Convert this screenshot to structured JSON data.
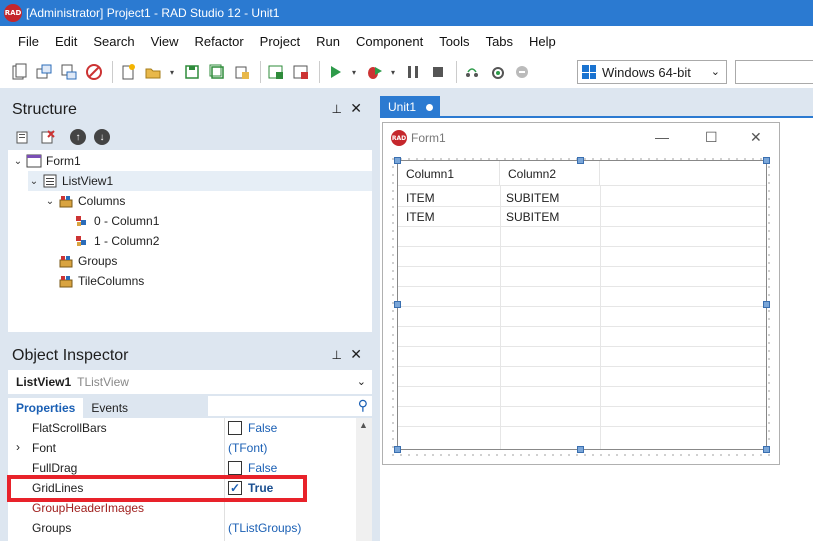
{
  "window": {
    "title": "[Administrator] Project1 - RAD Studio 12 - Unit1",
    "app_icon_text": "RAD"
  },
  "menu": [
    "File",
    "Edit",
    "Search",
    "View",
    "Refactor",
    "Project",
    "Run",
    "Component",
    "Tools",
    "Tabs",
    "Help"
  ],
  "toolbar": {
    "platform": "Windows 64-bit",
    "buttons": [
      "new-items-icon",
      "open-icon",
      "open-project-icon",
      "stop-icon",
      "new-file-icon",
      "open-folder-icon",
      "save-icon",
      "save-all-icon",
      "add-to-project-icon",
      "form-icon",
      "toggle-form-unit-icon",
      "run-icon",
      "run-dropdown-icon",
      "debug-icon",
      "debug-dropdown-icon",
      "pause-icon",
      "stop-run-icon",
      "step-over-icon",
      "trace-into-icon",
      "run-to-cursor-icon"
    ]
  },
  "structure": {
    "title": "Structure",
    "tree": [
      {
        "label": "Form1",
        "level": 0,
        "expanded": true,
        "icon": "form-icon"
      },
      {
        "label": "ListView1",
        "level": 1,
        "expanded": true,
        "icon": "listview-icon",
        "selected": true
      },
      {
        "label": "Columns",
        "level": 2,
        "expanded": true,
        "icon": "collection-icon"
      },
      {
        "label": "0 - Column1",
        "level": 3,
        "icon": "item-icon"
      },
      {
        "label": "1 - Column2",
        "level": 3,
        "icon": "item-icon"
      },
      {
        "label": "Groups",
        "level": 2,
        "icon": "collection-icon"
      },
      {
        "label": "TileColumns",
        "level": 2,
        "icon": "collection-icon"
      }
    ]
  },
  "inspector": {
    "title": "Object Inspector",
    "object_name": "ListView1",
    "object_type": "TListView",
    "tabs": [
      "Properties",
      "Events"
    ],
    "properties": [
      {
        "name": "FlatScrollBars",
        "value": "False",
        "checkbox": true,
        "checked": false
      },
      {
        "name": "Font",
        "value": "(TFont)",
        "expandable": true
      },
      {
        "name": "FullDrag",
        "value": "False",
        "checkbox": true,
        "checked": false
      },
      {
        "name": "GridLines",
        "value": "True",
        "checkbox": true,
        "checked": true,
        "bold": true
      },
      {
        "name": "GroupHeaderImages",
        "value": "",
        "reference": true
      },
      {
        "name": "Groups",
        "value": "(TListGroups)"
      }
    ]
  },
  "editor": {
    "tab": "Unit1",
    "form_caption": "Form1",
    "listview": {
      "columns": [
        "Column1",
        "Column2"
      ],
      "rows": [
        [
          "ITEM",
          "SUBITEM"
        ],
        [
          "ITEM",
          "SUBITEM"
        ]
      ]
    }
  }
}
